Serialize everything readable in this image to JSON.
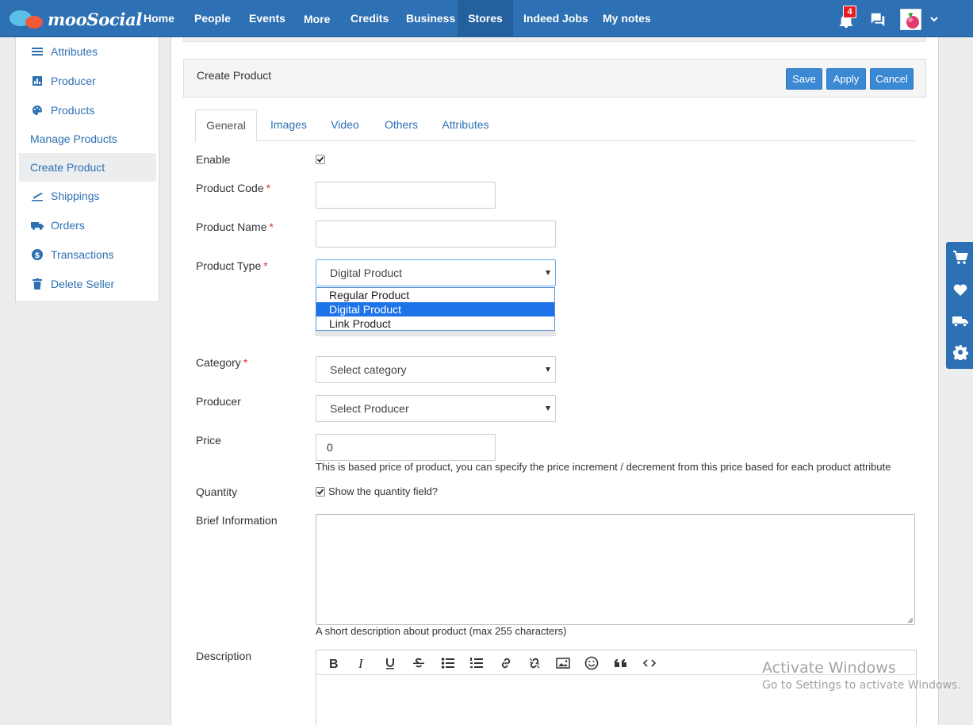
{
  "brand": {
    "name": "mooSocial"
  },
  "nav": {
    "items": [
      "Home",
      "People",
      "Events",
      "More",
      "Credits",
      "Business",
      "Stores",
      "Indeed Jobs",
      "My notes"
    ],
    "active": "Stores",
    "notification_count": "4"
  },
  "sidebar": {
    "items": [
      {
        "label": "Attributes",
        "icon": "list-icon"
      },
      {
        "label": "Producer",
        "icon": "chart-icon"
      },
      {
        "label": "Products",
        "icon": "palette-icon"
      },
      {
        "label": "Manage Products",
        "icon": ""
      },
      {
        "label": "Create Product",
        "icon": "",
        "active": true
      },
      {
        "label": "Shippings",
        "icon": "plane-icon"
      },
      {
        "label": "Orders",
        "icon": "truck-icon"
      },
      {
        "label": "Transactions",
        "icon": "dollar-icon"
      },
      {
        "label": "Delete Seller",
        "icon": "trash-icon"
      }
    ]
  },
  "header": {
    "title": "Create Product",
    "save_label": "Save",
    "apply_label": "Apply",
    "cancel_label": "Cancel"
  },
  "tabs": {
    "items": [
      "General",
      "Images",
      "Video",
      "Others",
      "Attributes"
    ],
    "active": "General"
  },
  "form": {
    "enable_label": "Enable",
    "enable_checked": true,
    "code_label": "Product Code",
    "code_value": "",
    "name_label": "Product Name",
    "name_value": "",
    "type_label": "Product Type",
    "type_value": "Digital Product",
    "type_options": [
      "Regular Product",
      "Digital Product",
      "Link Product"
    ],
    "category_label": "Category",
    "category_value": "Select category",
    "producer_label": "Producer",
    "producer_value": "Select Producer",
    "price_label": "Price",
    "price_value": "0",
    "price_help": "This is based price of product, you can specify the price increment / decrement from this price based for each product attribute",
    "quantity_label": "Quantity",
    "quantity_checkbox_label": "Show the quantity field?",
    "quantity_checked": true,
    "brief_label": "Brief Information",
    "brief_help": "A short description about product (max 255 characters)",
    "description_label": "Description",
    "required_mark": "*"
  },
  "editor_toolbar": [
    "bold-icon",
    "italic-icon",
    "underline-icon",
    "strikethrough-icon",
    "bullet-list-icon",
    "numbered-list-icon",
    "link-icon",
    "unlink-icon",
    "image-icon",
    "emoji-icon",
    "quote-icon",
    "code-icon"
  ],
  "floatbar": [
    "cart-icon",
    "heart-icon",
    "truck-icon",
    "gear-icon"
  ],
  "watermark": {
    "title": "Activate Windows",
    "subtitle": "Go to Settings to activate Windows."
  },
  "colors": {
    "brand": "#2d70b3",
    "button": "#3b88d3",
    "selected_option": "#1e73e8",
    "badge": "#e51c23"
  }
}
